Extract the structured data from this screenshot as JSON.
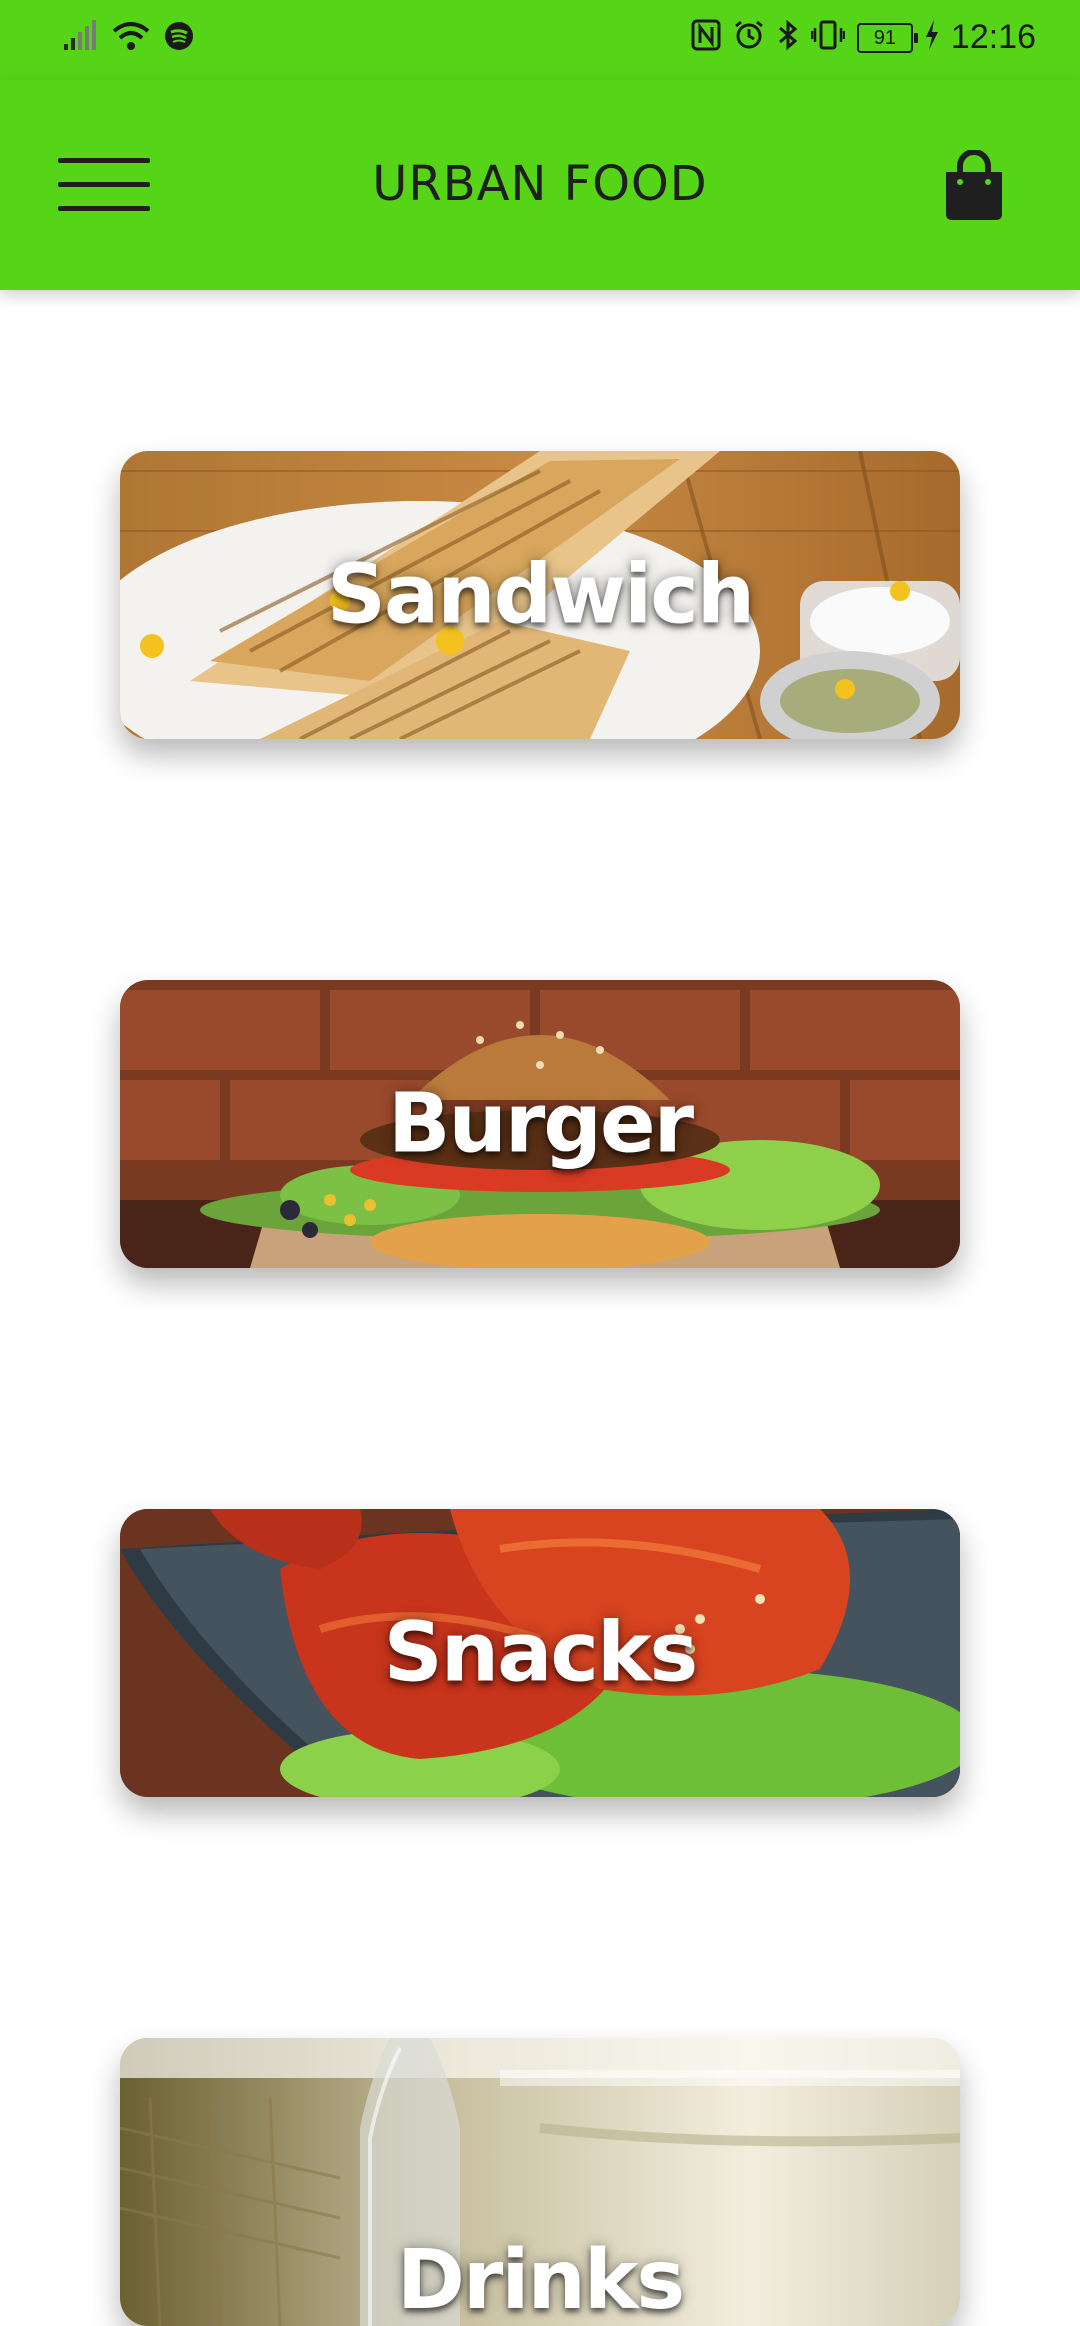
{
  "status_bar": {
    "time": "12:16",
    "battery": "91",
    "left_icons": [
      "signal-icon",
      "wifi-icon",
      "spotify-icon"
    ],
    "right_icons": [
      "nfc-icon",
      "alarm-icon",
      "bluetooth-icon",
      "vibrate-icon",
      "battery-icon",
      "charging-icon"
    ]
  },
  "app_bar": {
    "title": "URBAN FOOD",
    "menu_icon": "hamburger-menu-icon",
    "cart_icon": "shopping-bag-icon",
    "color": "#55d418"
  },
  "categories": [
    {
      "label": "Sandwich"
    },
    {
      "label": "Burger"
    },
    {
      "label": "Snacks"
    },
    {
      "label": "Drinks"
    }
  ]
}
